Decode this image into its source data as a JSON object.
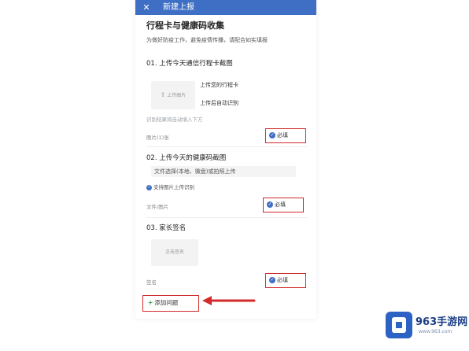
{
  "window": {
    "title": "新建上报"
  },
  "form": {
    "title": "行程卡与健康码收集",
    "description": "为做好防疫工作，避免疫情传播，请配合如实填报"
  },
  "sections": [
    {
      "number_title": "01. 上传今天通信行程卡截图",
      "upload_hints": [
        "上传您的行程卡",
        "上传后自动识别"
      ],
      "upload_box_label": "上传图片",
      "extra_line": "识别结果将自动填入下方",
      "meta": "图片(1)张",
      "required_label": "必填"
    },
    {
      "number_title": "02. 上传今天的健康码截图",
      "file_input": "文件选择(本地、微盘)或拍照上传",
      "support_label": "支持图片上传识别",
      "meta": "文件/图片",
      "required_label": "必填"
    },
    {
      "number_title": "03. 家长签名",
      "upload_box_label": "点击签名",
      "meta": "签名",
      "required_label": "必填"
    }
  ],
  "actions": {
    "add_question_label": "添加问题"
  },
  "icons": {
    "close": "close-icon",
    "check": "check-circle-icon",
    "plus": "plus-icon",
    "upload": "upload-icon",
    "arrow": "arrow-left-icon"
  },
  "colors": {
    "header": "#3f6fc4",
    "highlight": "#d12b2b",
    "add": "#2e9a4b"
  },
  "watermark": {
    "brand": "963手游网",
    "site": "www.963.com"
  }
}
